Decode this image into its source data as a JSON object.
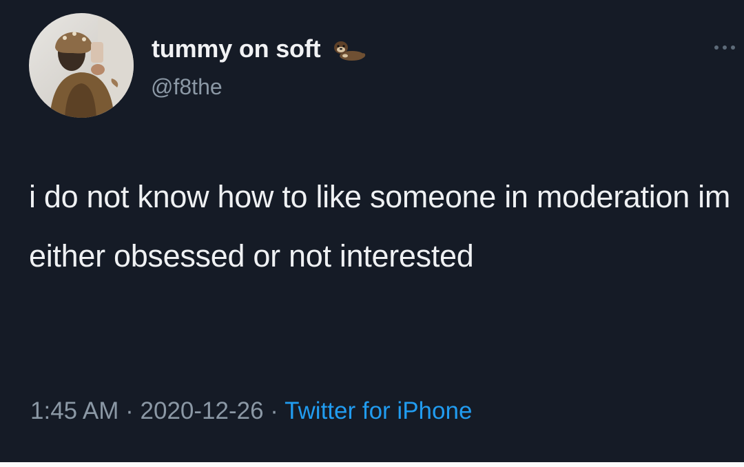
{
  "user": {
    "display_name": "tummy on soft",
    "handle": "@f8the",
    "name_emoji_icon": "otter-icon",
    "avatar_icon": "profile-photo-avatar"
  },
  "tweet": {
    "text": "i do not know how to like someone in moderation im either obsessed or not interested",
    "time": "1:45 AM",
    "date": "2020-12-26",
    "separator": " · ",
    "source": "Twitter for iPhone"
  },
  "toolbar": {
    "more_icon": "more-horizontal-icon"
  },
  "colors": {
    "background": "#151b26",
    "primary_text": "#eff1f3",
    "secondary_text": "#8b98a5",
    "accent": "#219cf0"
  }
}
